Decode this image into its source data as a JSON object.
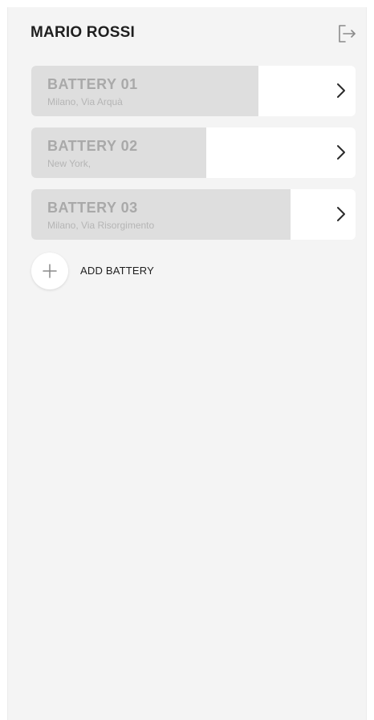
{
  "header": {
    "user_name": "MARIO ROSSI",
    "logout_icon": "logout-icon"
  },
  "batteries": [
    {
      "title": "BATTERY 01",
      "location": "Milano, Via Arquà",
      "charge_percent": 70,
      "chevron_icon": "chevron-right-icon"
    },
    {
      "title": "BATTERY 02",
      "location": "New York,",
      "charge_percent": 54,
      "chevron_icon": "chevron-right-icon"
    },
    {
      "title": "BATTERY 03",
      "location": "Milano, Via Risorgimento",
      "charge_percent": 80,
      "chevron_icon": "chevron-right-icon"
    }
  ],
  "add_battery": {
    "label": "ADD BATTERY",
    "icon": "plus-icon"
  },
  "colors": {
    "background": "#f4f4f4",
    "card": "#ffffff",
    "charge_fill": "#dedede",
    "title_text": "#a9a9a9",
    "primary_text": "#1f1f1f"
  }
}
